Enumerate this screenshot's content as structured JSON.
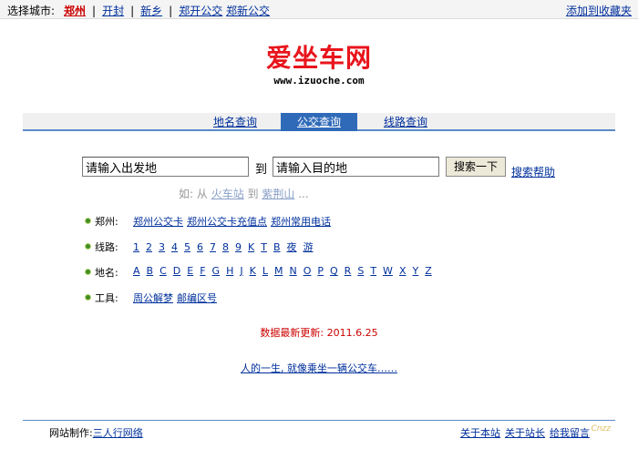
{
  "topbar": {
    "label": "选择城市:",
    "cities": [
      "郑州",
      "开封",
      "新乡",
      "郑开公交",
      "郑新公交"
    ],
    "separator": "|",
    "favorite": "添加到收藏夹"
  },
  "logo": {
    "title": "爱坐车网",
    "url": "www.izuoche.com"
  },
  "tabs": [
    "地名查询",
    "公交查询",
    "线路查询"
  ],
  "search": {
    "from_value": "请输入出发地",
    "to_label": "到",
    "to_value": "请输入目的地",
    "button": "搜索一下",
    "help": "搜索帮助"
  },
  "example": {
    "prefix": "如: 从",
    "from": "火车站",
    "mid": "到",
    "to": "紫荆山",
    "suffix": "..."
  },
  "rows": {
    "zhengzhou": {
      "label": "郑州:",
      "items": [
        "郑州公交卡",
        "郑州公交卡充值点",
        "郑州常用电话"
      ]
    },
    "lines": {
      "label": "线路:",
      "items": [
        "1",
        "2",
        "3",
        "4",
        "5",
        "6",
        "7",
        "8",
        "9",
        "K",
        "T",
        "B",
        "夜",
        "游"
      ]
    },
    "places": {
      "label": "地名:",
      "items": [
        "A",
        "B",
        "C",
        "D",
        "E",
        "F",
        "G",
        "H",
        "J",
        "K",
        "L",
        "M",
        "N",
        "O",
        "P",
        "Q",
        "R",
        "S",
        "T",
        "W",
        "X",
        "Y",
        "Z"
      ]
    },
    "tools": {
      "label": "工具:",
      "items": [
        "周公解梦",
        "邮编区号"
      ]
    }
  },
  "update": "数据最新更新: 2011.6.25",
  "motto": "人的一生, 就像乘坐一辆公交车……",
  "footer": {
    "made_label": "网站制作:",
    "made_link": "三人行网络",
    "links": [
      "关于本站",
      "关于站长",
      "给我留言"
    ],
    "mark": "Cnzz"
  },
  "colors": {
    "accent": "#2f6ab9",
    "logo_red": "#e8141c",
    "link": "#00309c",
    "update_red": "#cc0000"
  }
}
